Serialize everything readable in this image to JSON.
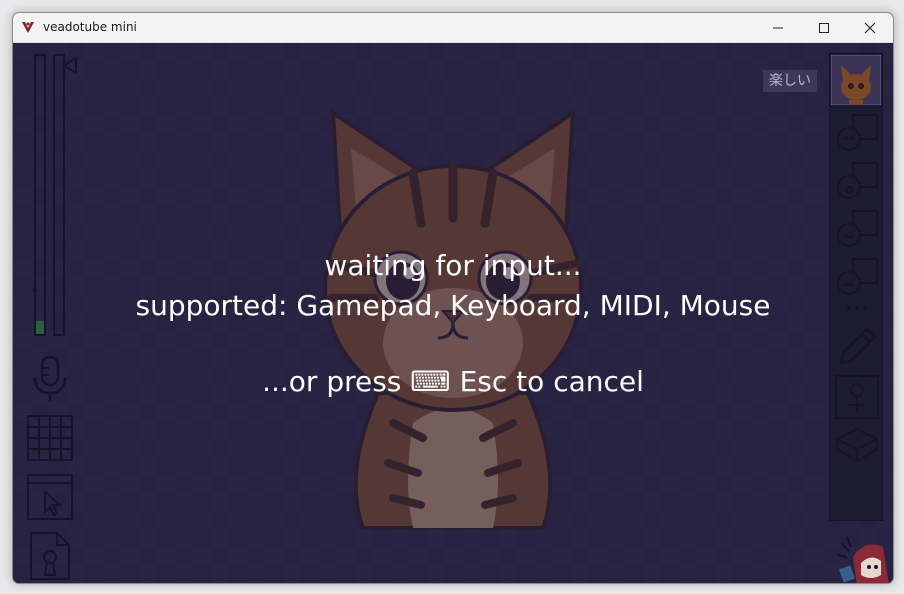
{
  "window": {
    "title": "veadotube mini"
  },
  "overlay": {
    "line1": "waiting for input...",
    "line2": "supported: Gamepad, Keyboard, MIDI, Mouse",
    "line3": "...or press ⌨ Esc to cancel"
  },
  "mood": {
    "label": "楽しい"
  },
  "colors": {
    "stage": "#2c2743",
    "icon_stroke": "#15122a",
    "mic_level": "#2e5d3a"
  }
}
